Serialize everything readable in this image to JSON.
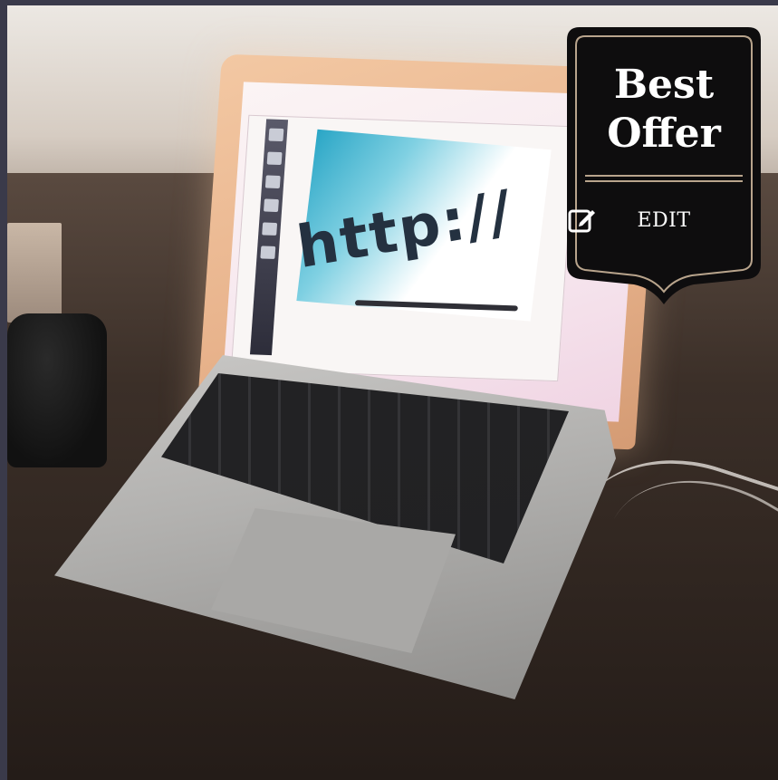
{
  "badge": {
    "title_line1": "Best",
    "title_line2": "Offer",
    "edit_label": "EDIT",
    "icon": "edit-icon"
  },
  "screen": {
    "displayed_text": "http://"
  },
  "colors": {
    "badge_background": "#0e0d0e",
    "badge_border": "#b8a48c",
    "badge_text": "#ffffff"
  }
}
